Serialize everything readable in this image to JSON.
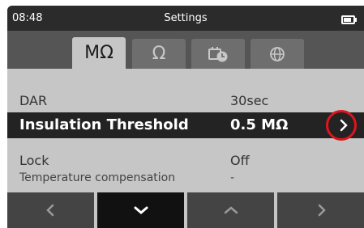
{
  "status": {
    "time": "08:48",
    "title": "Settings",
    "battery_level": 0.8
  },
  "tabs": [
    {
      "label": "MΩ",
      "active": true
    },
    {
      "label": "Ω",
      "active": false
    },
    {
      "label": "",
      "icon": "timer-battery-icon",
      "active": false
    },
    {
      "label": "",
      "icon": "globe-icon",
      "active": false
    }
  ],
  "rows": [
    {
      "label": "DAR",
      "value": "30sec"
    },
    {
      "label": "Insulation Threshold",
      "value": "0.5 MΩ",
      "highlighted": true,
      "chevron": "chevron-right-icon"
    },
    {
      "label": "Lock",
      "value": "Off"
    },
    {
      "label": "Temperature compensation",
      "value": "-"
    }
  ],
  "navbar": [
    {
      "icon": "chevron-left-icon"
    },
    {
      "icon": "chevron-down-icon",
      "active": true
    },
    {
      "icon": "chevron-up-icon"
    },
    {
      "icon": "chevron-right-icon"
    }
  ],
  "colors": {
    "background": "#c6c6c6",
    "statusbar": "#2b2b2b",
    "highlight_row": "#232323",
    "annotation_ring": "#e0141c"
  }
}
